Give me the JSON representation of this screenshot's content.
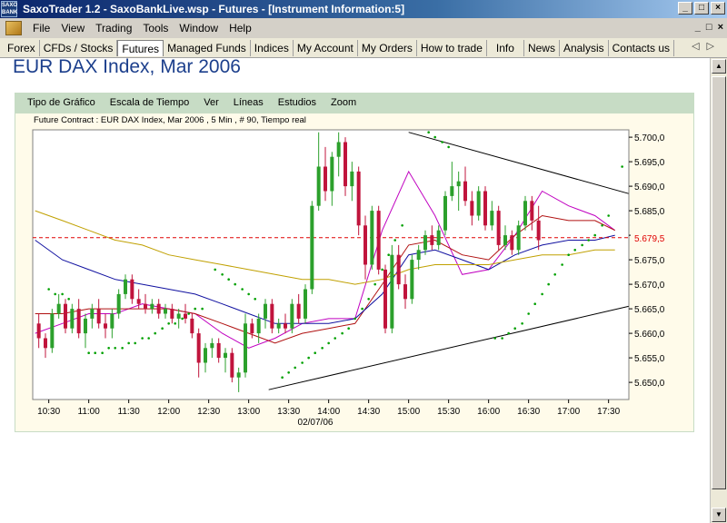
{
  "window": {
    "app_icon_text": "SAXO BANK",
    "title": "SaxoTrader 1.2 - SaxoBankLive.wsp - Futures - [Instrument Information:5]",
    "buttons": [
      "_",
      "□",
      "×"
    ]
  },
  "menu": {
    "items": [
      "File",
      "View",
      "Trading",
      "Tools",
      "Window",
      "Help"
    ],
    "mdi_buttons": [
      "_",
      "□",
      "×"
    ]
  },
  "tabs": {
    "items": [
      "Forex",
      "CFDs / Stocks",
      "Futures",
      "Managed Funds",
      "Indices",
      "My Account",
      "My Orders",
      "How to trade",
      "Info",
      "News",
      "Analysis",
      "Contacts us"
    ],
    "active": "Futures",
    "arrows": [
      "◁",
      "▷"
    ]
  },
  "page": {
    "title": "EUR DAX Index, Mar 2006"
  },
  "chart_toolbar": {
    "items": [
      "Tipo de Gráfico",
      "Escala de Tiempo",
      "Ver",
      "Líneas",
      "Estudios",
      "Zoom"
    ]
  },
  "colors": {
    "titlebar": "#0a246a",
    "chart_background": "#fffbea",
    "chart_toolbar": "#c7dcc5",
    "up_candle": "#2ca02c",
    "down_candle": "#c0143c",
    "last_price": "#e00000",
    "sma_short": "#c000c0",
    "sma_mid": "#b01010",
    "sma_long": "#1010a0",
    "sma_xlong": "#c0a000",
    "parabolic_sar": "#00a000"
  },
  "chart_data": {
    "type": "candlestick",
    "title": "Future Contract : EUR DAX Index, Mar 2006 , 5 Min , # 90, Tiempo real",
    "date_label": "02/07/06",
    "x_ticks": [
      "10:30",
      "11:00",
      "11:30",
      "12:00",
      "12:30",
      "13:00",
      "13:30",
      "14:00",
      "14:30",
      "15:00",
      "15:30",
      "16:00",
      "16:30",
      "17:00",
      "17:30"
    ],
    "y_ticks": [
      "5.650,0",
      "5.655,0",
      "5.660,0",
      "5.665,0",
      "5.670,0",
      "5.675,0",
      "5.680,0",
      "5.685,0",
      "5.690,0",
      "5.695,0",
      "5.700,0"
    ],
    "ylim": [
      5646.5,
      5701.5
    ],
    "last_price": 5679.5,
    "last_price_label": "5.679,5",
    "interval_minutes": 5,
    "start_time": "10:20",
    "candles": [
      [
        5662,
        5664,
        5657,
        5659
      ],
      [
        5659,
        5660,
        5655,
        5657
      ],
      [
        5657,
        5665,
        5656,
        5664
      ],
      [
        5664,
        5668,
        5663,
        5666
      ],
      [
        5666,
        5667,
        5660,
        5661
      ],
      [
        5661,
        5666,
        5660,
        5665
      ],
      [
        5665,
        5667,
        5659,
        5660
      ],
      [
        5660,
        5664,
        5657,
        5663
      ],
      [
        5663,
        5666,
        5661,
        5665
      ],
      [
        5665,
        5667,
        5661,
        5662
      ],
      [
        5662,
        5664,
        5659,
        5661
      ],
      [
        5661,
        5665,
        5659,
        5664
      ],
      [
        5664,
        5669,
        5663,
        5668
      ],
      [
        5668,
        5672,
        5667,
        5671
      ],
      [
        5671,
        5672,
        5666,
        5667
      ],
      [
        5667,
        5669,
        5665,
        5666
      ],
      [
        5666,
        5668,
        5664,
        5665
      ],
      [
        5665,
        5667,
        5664,
        5666
      ],
      [
        5666,
        5667,
        5663,
        5664
      ],
      [
        5664,
        5666,
        5663,
        5665
      ],
      [
        5665,
        5666,
        5662,
        5663
      ],
      [
        5663,
        5665,
        5661,
        5664
      ],
      [
        5664,
        5666,
        5662,
        5663
      ],
      [
        5663,
        5664,
        5659,
        5660
      ],
      [
        5660,
        5661,
        5651,
        5654
      ],
      [
        5654,
        5658,
        5652,
        5657
      ],
      [
        5657,
        5659,
        5655,
        5658
      ],
      [
        5658,
        5659,
        5654,
        5655
      ],
      [
        5655,
        5657,
        5652,
        5656
      ],
      [
        5656,
        5657,
        5650,
        5651
      ],
      [
        5651,
        5653,
        5648,
        5652
      ],
      [
        5652,
        5664,
        5651,
        5662
      ],
      [
        5662,
        5663,
        5659,
        5660
      ],
      [
        5660,
        5664,
        5658,
        5663
      ],
      [
        5663,
        5667,
        5661,
        5666
      ],
      [
        5666,
        5667,
        5660,
        5661
      ],
      [
        5661,
        5663,
        5660,
        5662
      ],
      [
        5662,
        5664,
        5660,
        5661
      ],
      [
        5661,
        5667,
        5660,
        5666
      ],
      [
        5666,
        5668,
        5662,
        5663
      ],
      [
        5663,
        5670,
        5662,
        5669
      ],
      [
        5669,
        5687,
        5668,
        5686
      ],
      [
        5686,
        5701,
        5685,
        5694
      ],
      [
        5694,
        5698,
        5687,
        5689
      ],
      [
        5689,
        5697,
        5686,
        5696
      ],
      [
        5696,
        5701,
        5692,
        5699
      ],
      [
        5699,
        5700,
        5688,
        5690
      ],
      [
        5690,
        5695,
        5687,
        5693
      ],
      [
        5693,
        5694,
        5680,
        5682
      ],
      [
        5682,
        5684,
        5671,
        5674
      ],
      [
        5674,
        5686,
        5673,
        5685
      ],
      [
        5685,
        5686,
        5672,
        5673
      ],
      [
        5673,
        5674,
        5660,
        5661
      ],
      [
        5661,
        5678,
        5660,
        5676
      ],
      [
        5676,
        5678,
        5669,
        5670
      ],
      [
        5670,
        5672,
        5665,
        5667
      ],
      [
        5667,
        5676,
        5666,
        5675
      ],
      [
        5675,
        5678,
        5673,
        5677
      ],
      [
        5677,
        5681,
        5676,
        5680
      ],
      [
        5680,
        5682,
        5677,
        5678
      ],
      [
        5678,
        5682,
        5677,
        5681
      ],
      [
        5681,
        5689,
        5680,
        5688
      ],
      [
        5688,
        5695,
        5687,
        5690
      ],
      [
        5690,
        5693,
        5685,
        5691
      ],
      [
        5691,
        5694,
        5686,
        5687
      ],
      [
        5687,
        5689,
        5682,
        5684
      ],
      [
        5684,
        5690,
        5683,
        5689
      ],
      [
        5689,
        5690,
        5681,
        5682
      ],
      [
        5682,
        5687,
        5681,
        5685
      ],
      [
        5685,
        5686,
        5677,
        5678
      ],
      [
        5678,
        5682,
        5677,
        5680
      ],
      [
        5680,
        5681,
        5676,
        5677
      ],
      [
        5677,
        5683,
        5676,
        5682
      ],
      [
        5682,
        5688,
        5681,
        5687
      ],
      [
        5687,
        5688,
        5681,
        5683
      ],
      [
        5683,
        5686,
        5677,
        5679
      ]
    ],
    "studies": {
      "sma_short": [
        [
          10.33,
          5660
        ],
        [
          10.67,
          5662
        ],
        [
          11.0,
          5664
        ],
        [
          11.33,
          5664
        ],
        [
          11.67,
          5666
        ],
        [
          12.0,
          5665
        ],
        [
          12.33,
          5664
        ],
        [
          12.67,
          5660
        ],
        [
          13.0,
          5657
        ],
        [
          13.33,
          5659
        ],
        [
          13.67,
          5662
        ],
        [
          14.0,
          5663
        ],
        [
          14.33,
          5663
        ],
        [
          14.67,
          5681
        ],
        [
          15.0,
          5693
        ],
        [
          15.33,
          5684
        ],
        [
          15.67,
          5672
        ],
        [
          16.0,
          5673
        ],
        [
          16.33,
          5680
        ],
        [
          16.67,
          5689
        ],
        [
          17.0,
          5686
        ],
        [
          17.33,
          5684
        ],
        [
          17.58,
          5681
        ]
      ],
      "sma_mid": [
        [
          10.33,
          5664
        ],
        [
          10.67,
          5664
        ],
        [
          11.0,
          5665
        ],
        [
          11.33,
          5665
        ],
        [
          11.67,
          5665
        ],
        [
          12.0,
          5665
        ],
        [
          12.33,
          5664
        ],
        [
          12.67,
          5662
        ],
        [
          13.0,
          5660
        ],
        [
          13.33,
          5658
        ],
        [
          13.67,
          5660
        ],
        [
          14.0,
          5661
        ],
        [
          14.33,
          5662
        ],
        [
          14.67,
          5670
        ],
        [
          15.0,
          5678
        ],
        [
          15.33,
          5679
        ],
        [
          15.67,
          5676
        ],
        [
          16.0,
          5675
        ],
        [
          16.33,
          5680
        ],
        [
          16.67,
          5684
        ],
        [
          17.0,
          5683
        ],
        [
          17.33,
          5683
        ],
        [
          17.58,
          5681
        ]
      ],
      "sma_long": [
        [
          10.33,
          5679
        ],
        [
          10.67,
          5675
        ],
        [
          11.0,
          5673
        ],
        [
          11.33,
          5671
        ],
        [
          11.67,
          5670
        ],
        [
          12.0,
          5669
        ],
        [
          12.33,
          5668
        ],
        [
          12.67,
          5666
        ],
        [
          13.0,
          5664
        ],
        [
          13.33,
          5662
        ],
        [
          13.67,
          5662
        ],
        [
          14.0,
          5662
        ],
        [
          14.33,
          5663
        ],
        [
          14.67,
          5668
        ],
        [
          15.0,
          5676
        ],
        [
          15.33,
          5677
        ],
        [
          15.67,
          5675
        ],
        [
          16.0,
          5673
        ],
        [
          16.33,
          5676
        ],
        [
          16.67,
          5678
        ],
        [
          17.0,
          5679
        ],
        [
          17.33,
          5679
        ],
        [
          17.58,
          5680
        ]
      ],
      "sma_xlong": [
        [
          10.33,
          5685
        ],
        [
          10.67,
          5683
        ],
        [
          11.0,
          5681
        ],
        [
          11.33,
          5679
        ],
        [
          11.67,
          5678
        ],
        [
          12.0,
          5676
        ],
        [
          12.33,
          5675
        ],
        [
          12.67,
          5674
        ],
        [
          13.0,
          5673
        ],
        [
          13.33,
          5672
        ],
        [
          13.67,
          5671
        ],
        [
          14.0,
          5671
        ],
        [
          14.33,
          5670
        ],
        [
          14.67,
          5671
        ],
        [
          15.0,
          5673
        ],
        [
          15.33,
          5674
        ],
        [
          15.67,
          5674
        ],
        [
          16.0,
          5674
        ],
        [
          16.33,
          5675
        ],
        [
          16.67,
          5676
        ],
        [
          17.0,
          5676
        ],
        [
          17.33,
          5677
        ],
        [
          17.58,
          5677
        ]
      ]
    },
    "sar": [
      [
        10.5,
        5669
      ],
      [
        10.58,
        5668
      ],
      [
        10.67,
        5668
      ],
      [
        10.75,
        5667
      ],
      [
        11.0,
        5656
      ],
      [
        11.08,
        5656
      ],
      [
        11.17,
        5656
      ],
      [
        11.25,
        5657
      ],
      [
        11.33,
        5657
      ],
      [
        11.42,
        5657
      ],
      [
        11.5,
        5658
      ],
      [
        11.58,
        5658
      ],
      [
        11.67,
        5659
      ],
      [
        11.75,
        5659
      ],
      [
        11.83,
        5660
      ],
      [
        11.92,
        5661
      ],
      [
        12.0,
        5662
      ],
      [
        12.08,
        5662
      ],
      [
        12.17,
        5663
      ],
      [
        12.25,
        5664
      ],
      [
        12.33,
        5665
      ],
      [
        12.42,
        5665
      ],
      [
        12.58,
        5673
      ],
      [
        12.67,
        5672
      ],
      [
        12.75,
        5671
      ],
      [
        12.83,
        5670
      ],
      [
        12.92,
        5669
      ],
      [
        13.0,
        5668
      ],
      [
        13.08,
        5667
      ],
      [
        13.42,
        5651
      ],
      [
        13.5,
        5652
      ],
      [
        13.58,
        5653
      ],
      [
        13.67,
        5654
      ],
      [
        13.75,
        5655
      ],
      [
        13.83,
        5656
      ],
      [
        13.92,
        5657
      ],
      [
        14.0,
        5658
      ],
      [
        14.08,
        5659
      ],
      [
        14.17,
        5660
      ],
      [
        14.25,
        5661
      ],
      [
        14.33,
        5663
      ],
      [
        14.42,
        5665
      ],
      [
        14.5,
        5667
      ],
      [
        14.58,
        5670
      ],
      [
        14.67,
        5673
      ],
      [
        14.75,
        5676
      ],
      [
        14.83,
        5679
      ],
      [
        14.92,
        5682
      ],
      [
        15.25,
        5701
      ],
      [
        15.33,
        5700
      ],
      [
        15.42,
        5699
      ],
      [
        15.5,
        5698
      ],
      [
        16.08,
        5659
      ],
      [
        16.17,
        5659
      ],
      [
        16.25,
        5660
      ],
      [
        16.33,
        5661
      ],
      [
        16.42,
        5662
      ],
      [
        16.5,
        5664
      ],
      [
        16.58,
        5666
      ],
      [
        16.67,
        5668
      ],
      [
        16.75,
        5670
      ],
      [
        16.83,
        5672
      ],
      [
        16.92,
        5674
      ],
      [
        17.0,
        5676
      ],
      [
        17.08,
        5677
      ],
      [
        17.17,
        5678
      ],
      [
        17.25,
        5679
      ],
      [
        17.33,
        5680
      ],
      [
        17.42,
        5682
      ],
      [
        17.5,
        5684
      ],
      [
        17.67,
        5694
      ]
    ],
    "trendlines": [
      [
        [
          15.0,
          5701
        ],
        [
          17.75,
          5688.5
        ]
      ],
      [
        [
          13.25,
          5648.5
        ],
        [
          17.75,
          5665.5
        ]
      ]
    ]
  }
}
